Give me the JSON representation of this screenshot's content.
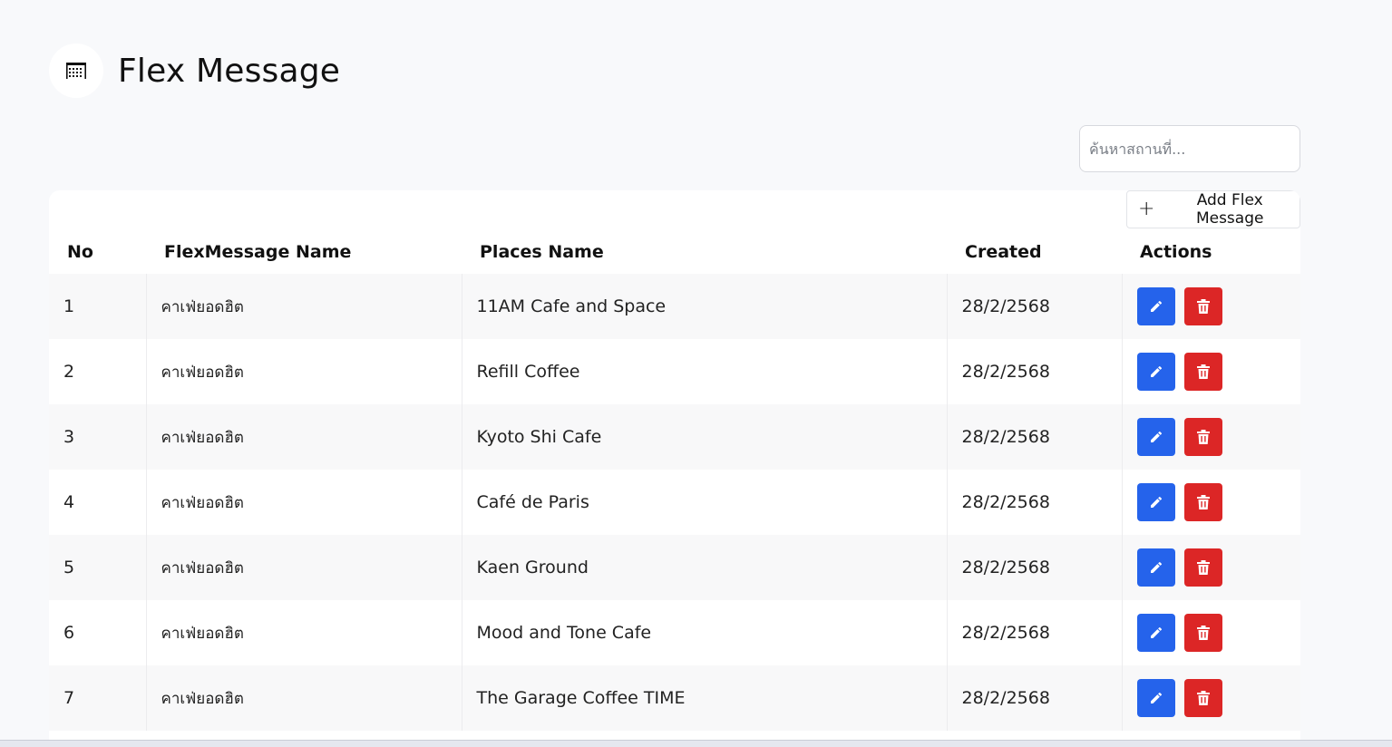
{
  "header": {
    "title": "Flex Message",
    "icon": "table-icon"
  },
  "search": {
    "placeholder": "ค้นหาสถานที่...",
    "value": ""
  },
  "toolbar": {
    "add_label": "Add Flex Message",
    "add_icon": "plus-icon"
  },
  "table": {
    "columns": {
      "no": "No",
      "flex_name": "FlexMessage Name",
      "places_name": "Places Name",
      "created": "Created",
      "actions": "Actions"
    },
    "rows": [
      {
        "no": "1",
        "flex_name": "คาเฟ่ยอดฮิต",
        "places_name": "11AM Cafe and Space",
        "created": "28/2/2568"
      },
      {
        "no": "2",
        "flex_name": "คาเฟ่ยอดฮิต",
        "places_name": "Refill Coffee",
        "created": "28/2/2568"
      },
      {
        "no": "3",
        "flex_name": "คาเฟ่ยอดฮิต",
        "places_name": "Kyoto Shi Cafe",
        "created": "28/2/2568"
      },
      {
        "no": "4",
        "flex_name": "คาเฟ่ยอดฮิต",
        "places_name": "Café de Paris",
        "created": "28/2/2568"
      },
      {
        "no": "5",
        "flex_name": "คาเฟ่ยอดฮิต",
        "places_name": "Kaen Ground",
        "created": "28/2/2568"
      },
      {
        "no": "6",
        "flex_name": "คาเฟ่ยอดฮิต",
        "places_name": "Mood and Tone Cafe",
        "created": "28/2/2568"
      },
      {
        "no": "7",
        "flex_name": "คาเฟ่ยอดฮิต",
        "places_name": "The Garage Coffee TIME",
        "created": "28/2/2568"
      }
    ]
  },
  "colors": {
    "edit": "#2563eb",
    "delete": "#dc2626",
    "background": "#f8f9fb"
  }
}
